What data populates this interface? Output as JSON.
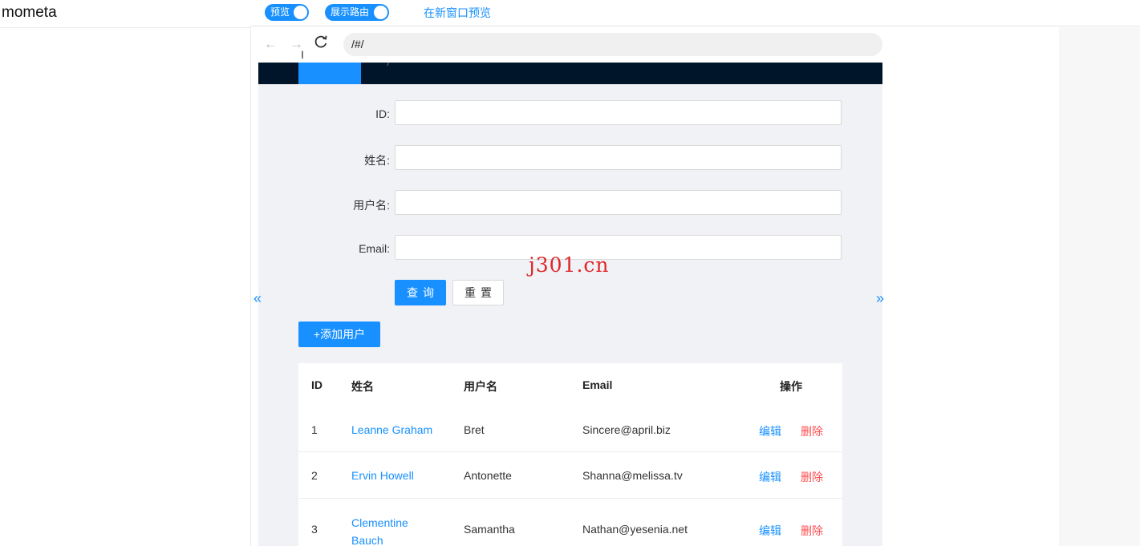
{
  "sidebar": {
    "title": "mometa"
  },
  "toolbar": {
    "preview_toggle": "预览",
    "route_toggle": "展示路由",
    "new_window_link": "在新窗口预览"
  },
  "browser": {
    "back_icon": "←",
    "forward_icon": "→",
    "reload_icon": "C",
    "url": "/#/"
  },
  "form": {
    "id_label": "ID",
    "name_label": "姓名",
    "username_label": "用户名",
    "email_label": "Email",
    "label_colon": ":",
    "query_button": "查询",
    "reset_button": "重置",
    "add_user_button": "+添加用户"
  },
  "table": {
    "columns": [
      "ID",
      "姓名",
      "用户名",
      "Email",
      "操作"
    ],
    "rows": [
      {
        "id": "1",
        "name": "Leanne Graham",
        "username": "Bret",
        "email": "Sincere@april.biz",
        "edit": "编辑",
        "delete": "删除"
      },
      {
        "id": "2",
        "name": "Ervin Howell",
        "username": "Antonette",
        "email": "Shanna@melissa.tv",
        "edit": "编辑",
        "delete": "删除"
      },
      {
        "id": "3",
        "name": "Clementine Bauch",
        "username": "Samantha",
        "email": "Nathan@yesenia.net",
        "edit": "编辑",
        "delete": "删除"
      }
    ]
  },
  "pager": {
    "prev": "«",
    "next": "»"
  },
  "watermark": "j301.cn",
  "colors": {
    "primary": "#1890ff",
    "danger": "#ff4d4f",
    "header_dark": "#001529",
    "frame_bg": "#f0f2f5"
  }
}
